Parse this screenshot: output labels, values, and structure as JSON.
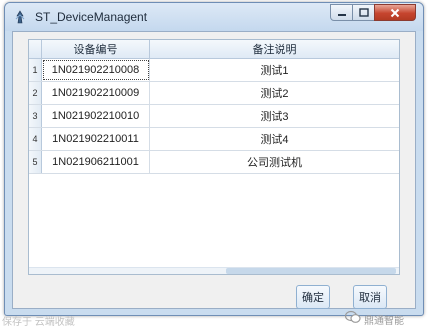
{
  "window": {
    "title": "ST_DeviceManagent",
    "controls": {
      "minimize_icon": "minimize-icon",
      "maximize_icon": "maximize-icon",
      "close_icon": "close-icon"
    }
  },
  "table": {
    "columns": [
      "设备编号",
      "备注说明"
    ],
    "rows": [
      {
        "num": "1",
        "device_id": "1N021902210008",
        "remark": "测试1"
      },
      {
        "num": "2",
        "device_id": "1N021902210009",
        "remark": "测试2"
      },
      {
        "num": "3",
        "device_id": "1N021902210010",
        "remark": "测试3"
      },
      {
        "num": "4",
        "device_id": "1N021902210011",
        "remark": "测试4"
      },
      {
        "num": "5",
        "device_id": "1N021906211001",
        "remark": "公司测试机"
      }
    ],
    "selected_row": 1
  },
  "buttons": {
    "ok_label": "确定",
    "cancel_label": "取消"
  },
  "watermarks": {
    "left": "保存于 云端收藏",
    "right": "鼎通智能"
  },
  "colors": {
    "title_bar": "#c4d8ee",
    "close_button": "#c6452f",
    "grid_header": "#dfeaf5"
  }
}
